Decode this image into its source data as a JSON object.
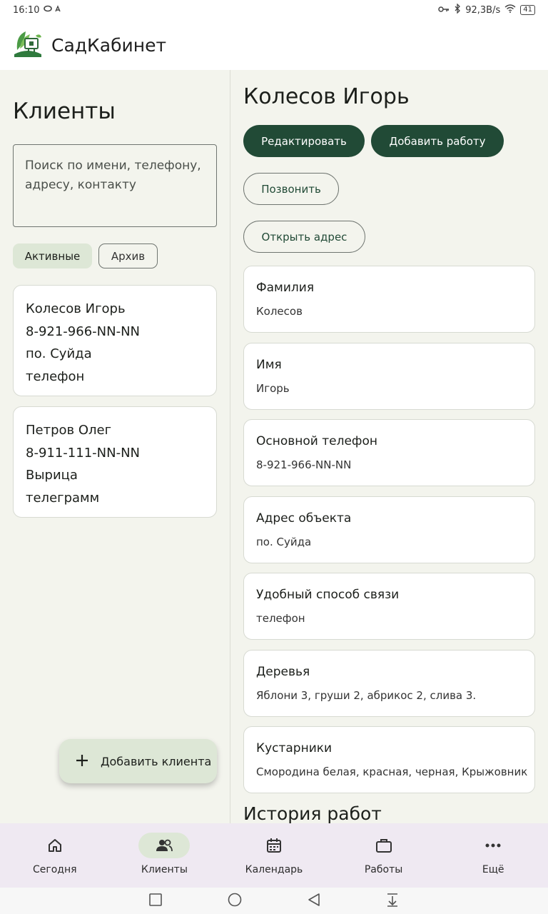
{
  "status_bar": {
    "time": "16:10",
    "network_speed": "92,3B/s",
    "battery": "41"
  },
  "app": {
    "title": "СадКабинет"
  },
  "clients": {
    "title": "Клиенты",
    "search_placeholder": "Поиск по имени, телефону, адресу, контакту",
    "filter_active": "Активные",
    "filter_archive": "Архив",
    "list": [
      {
        "name": "Колесов Игорь",
        "phone": "8-921-966-NN-NN",
        "address": "по. Суйда",
        "contact": "телефон"
      },
      {
        "name": "Петров Олег",
        "phone": "8-911-111-NN-NN",
        "address": "Вырица",
        "contact": "телеграмм"
      }
    ],
    "add_button": "Добавить клиента"
  },
  "detail": {
    "name": "Колесов Игорь",
    "edit_button": "Редактировать",
    "add_work_button": "Добавить работу",
    "call_button": "Позвонить",
    "open_address_button": "Открыть адрес",
    "fields": [
      {
        "label": "Фамилия",
        "value": "Колесов"
      },
      {
        "label": "Имя",
        "value": "Игорь"
      },
      {
        "label": "Основной телефон",
        "value": "8-921-966-NN-NN"
      },
      {
        "label": "Адрес объекта",
        "value": "по. Суйда"
      },
      {
        "label": "Удобный способ связи",
        "value": "телефон"
      },
      {
        "label": "Деревья",
        "value": "Яблони 3, груши 2, абрикос 2, слива 3."
      },
      {
        "label": "Кустарники",
        "value": "Смородина белая, красная, черная, Крыжовник"
      }
    ],
    "history_title": "История работ"
  },
  "bottom_nav": [
    {
      "label": "Сегодня",
      "icon": "home-icon"
    },
    {
      "label": "Клиенты",
      "icon": "people-icon",
      "active": true
    },
    {
      "label": "Календарь",
      "icon": "calendar-icon"
    },
    {
      "label": "Работы",
      "icon": "briefcase-icon"
    },
    {
      "label": "Ещё",
      "icon": "more-icon"
    }
  ],
  "colors": {
    "primary": "#214a36",
    "chip_active": "#dde7d6",
    "nav_background": "#efe9f2",
    "page_background": "#f3f4ed"
  }
}
